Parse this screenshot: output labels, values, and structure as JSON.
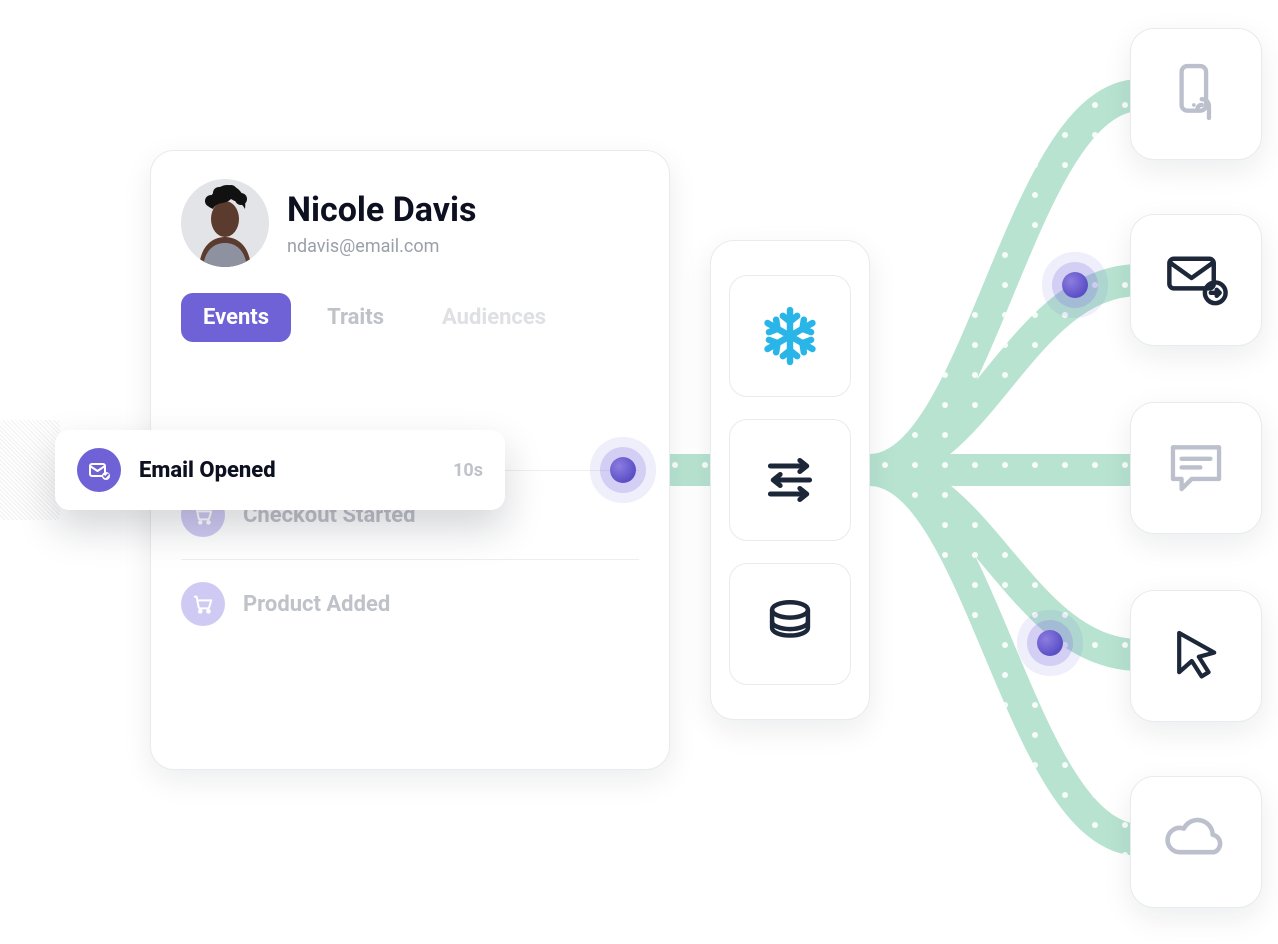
{
  "profile": {
    "name": "Nicole Davis",
    "email": "ndavis@email.com",
    "tabs": [
      {
        "label": "Events",
        "active": true
      },
      {
        "label": "Traits",
        "active": false
      },
      {
        "label": "Audiences",
        "active": false
      }
    ],
    "events": [
      {
        "label": "Checkout Started",
        "icon": "cart"
      },
      {
        "label": "Product Added",
        "icon": "cart"
      }
    ]
  },
  "front_event": {
    "label": "Email Opened",
    "time": "10s",
    "icon": "email-check"
  },
  "mid_stack": [
    {
      "name": "snowflake"
    },
    {
      "name": "reverse-etl"
    },
    {
      "name": "database"
    }
  ],
  "destinations": [
    {
      "name": "mobile-push"
    },
    {
      "name": "email-send"
    },
    {
      "name": "chat"
    },
    {
      "name": "cursor"
    },
    {
      "name": "cloud"
    }
  ],
  "colors": {
    "accent_purple": "#6F62D6",
    "flow_green": "#B7E3D0",
    "ink": "#1D273A",
    "icon_light": "#BBC0CC",
    "snowflake_blue": "#29B5E8"
  }
}
